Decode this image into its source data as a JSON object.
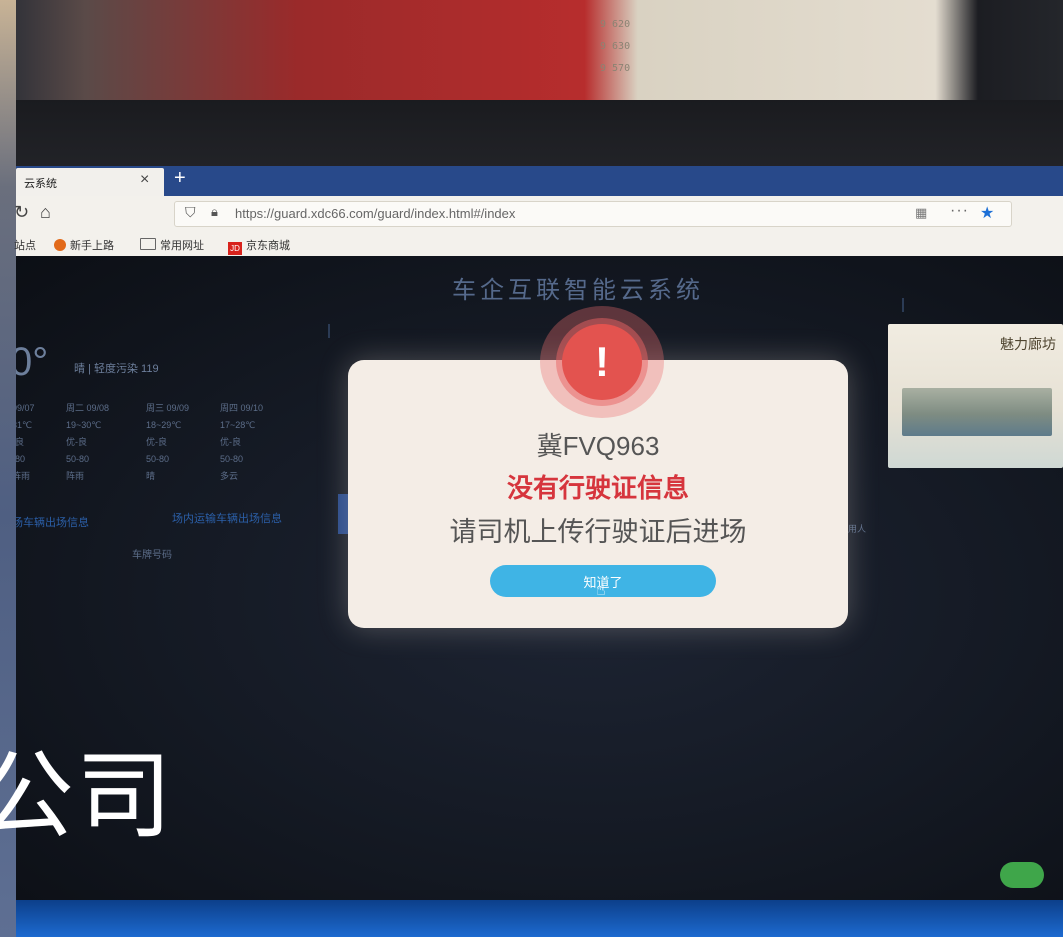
{
  "poster": {
    "lines": [
      "9 620",
      "9 630",
      "9 570"
    ]
  },
  "browser": {
    "tab_title": "云系统",
    "tab_close": "×",
    "new_tab": "+",
    "url": "https://guard.xdc66.com/guard/index.html#/index",
    "more": "···",
    "bookmarks": [
      "站点",
      "新手上路",
      "常用网址",
      "京东商城"
    ],
    "jd_badge": "JD"
  },
  "dashboard": {
    "title": "车企互联智能云系统",
    "temperature": "0°",
    "weather": "晴 | 轻度污染 119",
    "forecast": [
      {
        "day": "09/07",
        "temp": "31℃",
        "aqi": "-良",
        "range": "-80",
        "cond": "阵雨"
      },
      {
        "day": "周二 09/08",
        "temp": "19~30℃",
        "aqi": "优-良",
        "range": "50-80",
        "cond": "阵雨"
      },
      {
        "day": "周三 09/09",
        "temp": "18~29℃",
        "aqi": "优-良",
        "range": "50-80",
        "cond": "晴"
      },
      {
        "day": "周四 09/10",
        "temp": "17~28℃",
        "aqi": "优-良",
        "range": "50-80",
        "cond": "多云"
      }
    ],
    "tab_a": "场车辆出场信息",
    "tab_b": "场内运输车辆出场信息",
    "column_plate": "车牌号码",
    "side_label": "用人",
    "ad_title": "魅力廊坊"
  },
  "modal": {
    "icon": "!",
    "plate": "冀FVQ963",
    "error": "没有行驶证信息",
    "instruction": "请司机上传行驶证后进场",
    "ok_label": "知道了"
  },
  "overlay": {
    "company_text": "公司"
  },
  "colors": {
    "modal_bg": "#f4ede6",
    "error_red": "#d6353d",
    "button_blue": "#3fb4e5",
    "alert_red": "#e3534f"
  }
}
